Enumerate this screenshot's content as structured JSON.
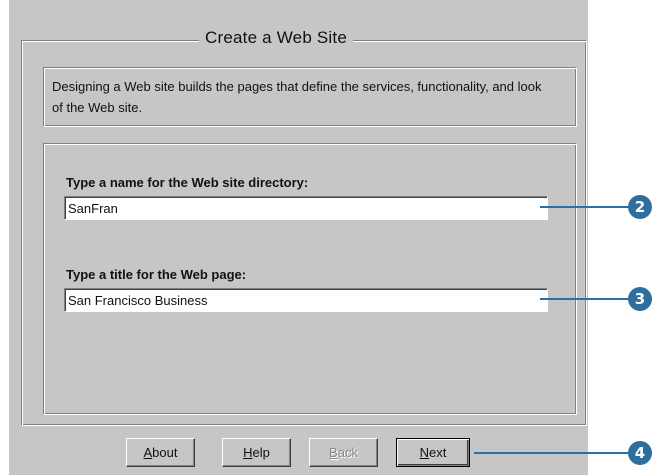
{
  "dialog": {
    "title": "Create a Web Site",
    "description": "Designing a Web site builds the pages that define the services, functionality, and look of the Web site."
  },
  "fields": {
    "directory": {
      "label": "Type a name for the Web site directory:",
      "value": "SanFran"
    },
    "page_title": {
      "label": "Type a title for the Web page:",
      "value": "San Francisco Business"
    }
  },
  "buttons": {
    "about": {
      "mnemonic": "A",
      "rest": "bout"
    },
    "help": {
      "mnemonic": "H",
      "rest": "elp"
    },
    "back": {
      "mnemonic": "B",
      "rest": "ack"
    },
    "next": {
      "mnemonic": "N",
      "rest": "ext"
    }
  },
  "callouts": {
    "directory_step": "2",
    "title_step": "3",
    "next_step": "4"
  },
  "colors": {
    "dialog_background": "#c6c6c6",
    "callout_blue": "#2f6f9f"
  }
}
